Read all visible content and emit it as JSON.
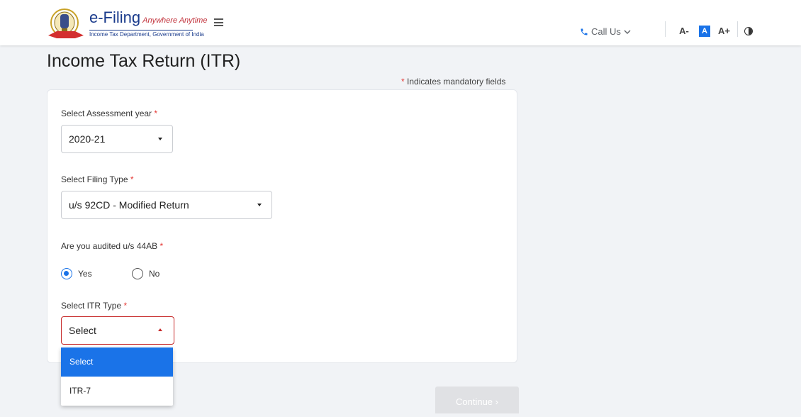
{
  "header": {
    "logo_main": "e-Filing",
    "logo_tagline": "Anywhere Anytime",
    "logo_sub": "Income Tax Department, Government of India",
    "call_us_label": "Call Us",
    "font_decrease": "A-",
    "font_default": "A",
    "font_increase": "A+",
    "icons": [
      "emblem-icon",
      "hamburger-menu-icon",
      "phone-icon",
      "chevron-down-icon",
      "contrast-icon"
    ]
  },
  "page": {
    "title": "Income Tax Return (ITR)",
    "mandatory_note": "Indicates mandatory fields",
    "required_marker": "*"
  },
  "form": {
    "assessment_year": {
      "label": "Select Assessment year",
      "value": "2020-21"
    },
    "filing_type": {
      "label": "Select Filing Type",
      "value": "u/s 92CD - Modified Return"
    },
    "audited": {
      "label": "Are you audited u/s 44AB",
      "options": [
        "Yes",
        "No"
      ],
      "selected": "Yes"
    },
    "itr_type": {
      "label": "Select ITR Type",
      "value": "Select",
      "options": [
        "Select",
        "ITR-7"
      ],
      "highlighted": "Select"
    }
  },
  "actions": {
    "continue_label": "Continue ›"
  },
  "colors": {
    "accent": "#1a73e8",
    "error": "#c62828",
    "brand": "#1a3b8c"
  }
}
